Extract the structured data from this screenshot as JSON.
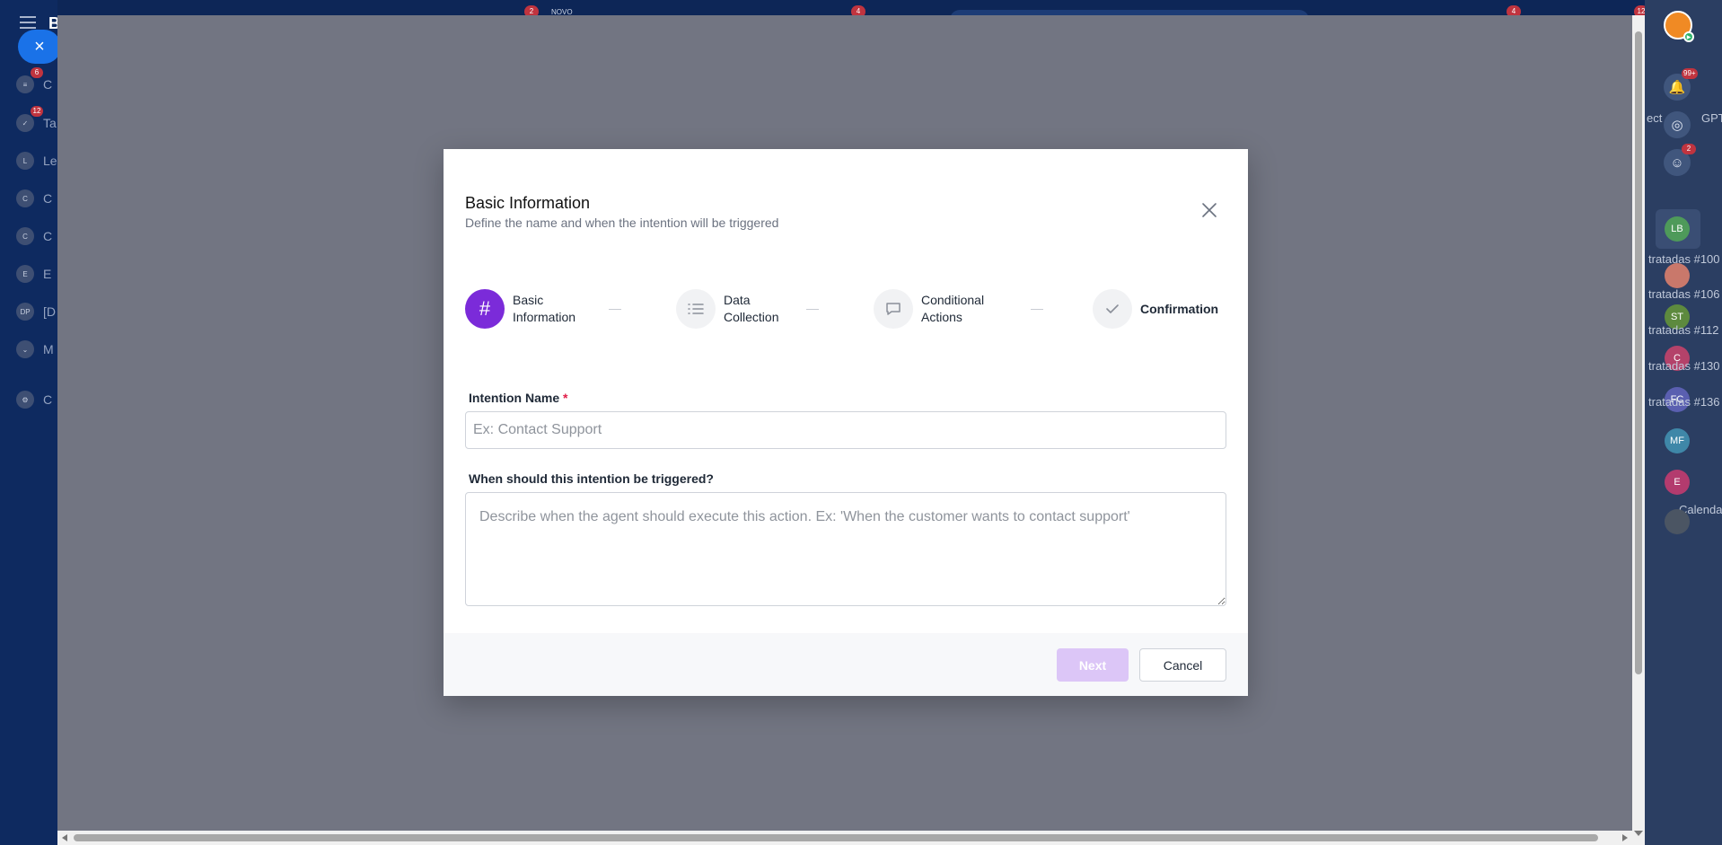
{
  "modal": {
    "title": "Basic Information",
    "subtitle": "Define the name and when the intention will be triggered",
    "steps": [
      {
        "label": "Basic Information",
        "icon": "hash-icon",
        "active": true
      },
      {
        "label": "Data Collection",
        "icon": "list-icon",
        "active": false
      },
      {
        "label": "Conditional Actions",
        "icon": "chat-bubble-icon",
        "active": false
      },
      {
        "label": "Confirmation",
        "icon": "check-icon",
        "active": false
      }
    ],
    "step_glyph_active": "#",
    "name_field": {
      "label": "Intention Name",
      "required_mark": "*",
      "value": "",
      "placeholder": "Ex: Contact Support"
    },
    "trigger_field": {
      "label": "When should this intention be triggered?",
      "value": "",
      "placeholder": "Describe when the agent should execute this action. Ex: 'When the customer wants to contact support'"
    },
    "next_label": "Next",
    "cancel_label": "Cancel"
  },
  "background": {
    "brand": "B",
    "close_glyph": "×",
    "novo": "NOVO",
    "top_badges": [
      "2",
      "4",
      "4",
      "12"
    ],
    "sidebar": [
      {
        "icon": "funnel-icon",
        "badge": "6",
        "letter": "C"
      },
      {
        "icon": "task-icon",
        "badge": "12",
        "letter": "Ta"
      },
      {
        "icon": "L",
        "badge": "",
        "letter": "Le"
      },
      {
        "icon": "C",
        "badge": "",
        "letter": "C"
      },
      {
        "icon": "C",
        "badge": "",
        "letter": "C"
      },
      {
        "icon": "E",
        "badge": "",
        "letter": "E"
      },
      {
        "icon": "DP",
        "badge": "",
        "letter": "[D"
      },
      {
        "icon": "chevron-down-icon",
        "badge": "",
        "letter": "M"
      },
      {
        "icon": "gear-icon",
        "badge": "",
        "letter": "C"
      }
    ],
    "right_panel": {
      "notification_badge": "99+",
      "chat_badge": "2",
      "text_ect": "ect",
      "text_gpt": "GPT",
      "contacts": [
        {
          "initials": "LB",
          "label": "tratadas #100",
          "color": "#4e9a5a"
        },
        {
          "initials": "",
          "label": "tratadas #106",
          "color": "#c9786b"
        },
        {
          "initials": "ST",
          "label": "tratadas #112",
          "color": "#5d8a3e"
        },
        {
          "initials": "C",
          "label": "tratadas #130",
          "color": "#b4426a"
        },
        {
          "initials": "FC",
          "label": "tratadas #136",
          "color": "#5a5fb0"
        },
        {
          "initials": "MF",
          "label": "",
          "color": "#3f87a8"
        },
        {
          "initials": "E",
          "label": "Calenda",
          "color": "#b33b6e"
        },
        {
          "initials": "",
          "label": "",
          "color": "#4b5563"
        }
      ]
    }
  }
}
